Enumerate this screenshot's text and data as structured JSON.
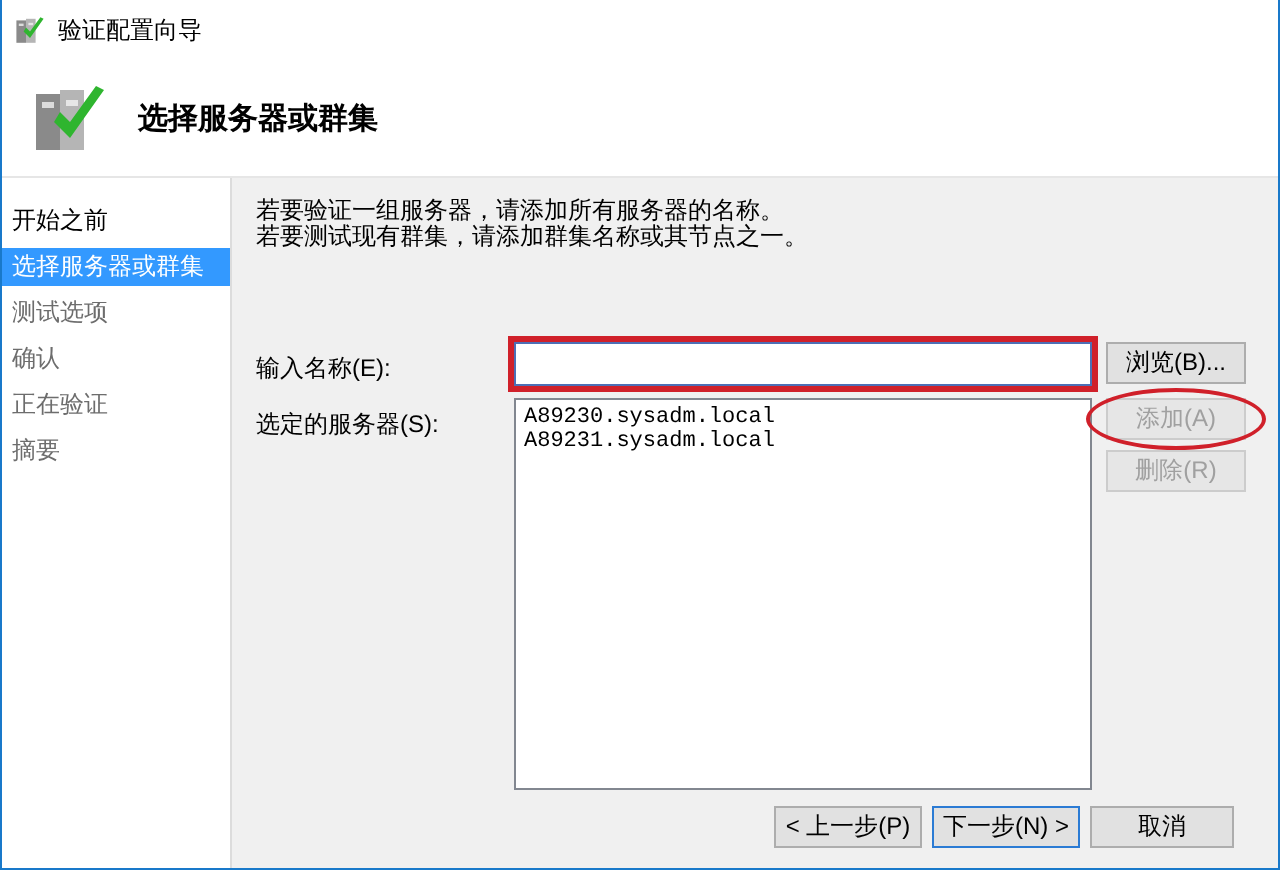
{
  "window": {
    "title": "验证配置向导"
  },
  "header": {
    "title": "选择服务器或群集"
  },
  "sidebar": {
    "items": [
      {
        "label": "开始之前",
        "selected": false,
        "disabled": false
      },
      {
        "label": "选择服务器或群集",
        "selected": true,
        "disabled": false
      },
      {
        "label": "测试选项",
        "selected": false,
        "disabled": true
      },
      {
        "label": "确认",
        "selected": false,
        "disabled": true
      },
      {
        "label": "正在验证",
        "selected": false,
        "disabled": true
      },
      {
        "label": "摘要",
        "selected": false,
        "disabled": true
      }
    ]
  },
  "description": [
    "若要验证一组服务器，请添加所有服务器的名称。",
    "若要测试现有群集，请添加群集名称或其节点之一。"
  ],
  "name_field": {
    "label": "输入名称(E):",
    "highlighted": true
  },
  "browse_button": {
    "label": "浏览(B)...",
    "disabled": false
  },
  "servers": {
    "label": "选定的服务器(S):",
    "items": [
      "A89230.sysadm.local",
      "A89231.sysadm.local"
    ]
  },
  "side_buttons": [
    {
      "label": "添加(A)",
      "disabled": true,
      "highlighted": true
    },
    {
      "label": "删除(R)",
      "disabled": true,
      "highlighted": false
    }
  ],
  "footer_buttons": [
    {
      "label": "< 上一步(P)",
      "default": false
    },
    {
      "label": "下一步(N) >",
      "default": true
    },
    {
      "label": "取消",
      "default": false
    }
  ]
}
